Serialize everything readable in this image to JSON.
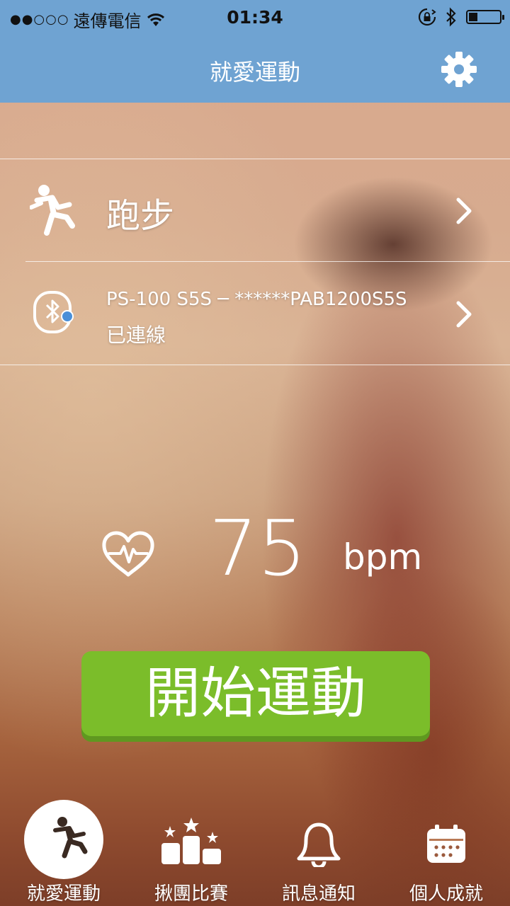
{
  "status_bar": {
    "signal_dots": "●●○○○",
    "carrier": "遠傳電信",
    "time": "01:34"
  },
  "header": {
    "title": "就愛運動"
  },
  "activity": {
    "label": "跑步"
  },
  "device": {
    "name": "PS-100 S5S ─ ******PAB1200S5S",
    "status": "已連線"
  },
  "heart_rate": {
    "value": "75",
    "unit": "bpm"
  },
  "start_button": {
    "label": "開始運動"
  },
  "tabs": [
    {
      "label": "就愛運動",
      "icon": "runner-icon",
      "active": true
    },
    {
      "label": "揪團比賽",
      "icon": "podium-stars-icon",
      "active": false
    },
    {
      "label": "訊息通知",
      "icon": "bell-icon",
      "active": false
    },
    {
      "label": "個人成就",
      "icon": "calendar-icon",
      "active": false
    }
  ],
  "colors": {
    "header_bg": "#6fa3d2",
    "start_button": "#7bbd2a",
    "bluetooth_dot": "#4a8fd8"
  }
}
